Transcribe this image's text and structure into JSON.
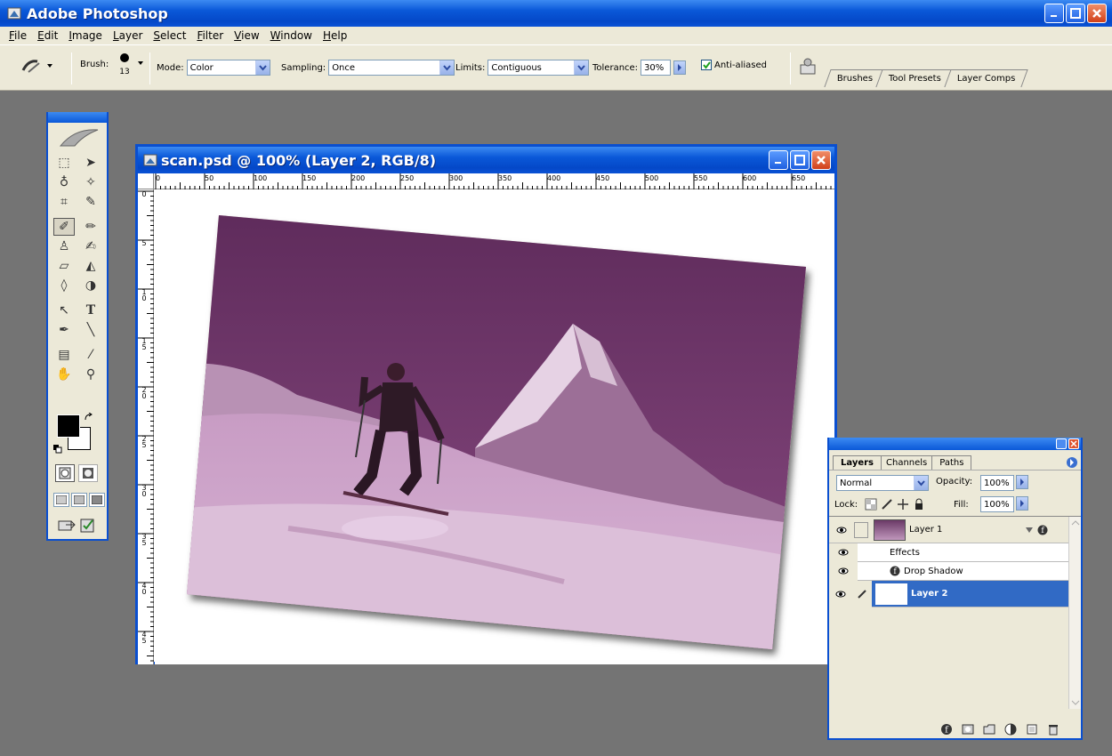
{
  "app": {
    "title": "Adobe Photoshop"
  },
  "menu": {
    "items": [
      "File",
      "Edit",
      "Image",
      "Layer",
      "Select",
      "Filter",
      "View",
      "Window",
      "Help"
    ]
  },
  "options": {
    "brush_label": "Brush:",
    "brush_size": "13",
    "mode_label": "Mode:",
    "mode_value": "Color",
    "sampling_label": "Sampling:",
    "sampling_value": "Once",
    "limits_label": "Limits:",
    "limits_value": "Contiguous",
    "tolerance_label": "Tolerance:",
    "tolerance_value": "30%",
    "antialiased_label": "Anti-aliased",
    "antialiased_checked": true
  },
  "palette_well": {
    "tabs": [
      "Brushes",
      "Tool Presets",
      "Layer Comps"
    ]
  },
  "document": {
    "title": "scan.psd @ 100% (Layer 2, RGB/8)",
    "ruler_h": [
      "0",
      "50",
      "100",
      "150",
      "200",
      "250",
      "300",
      "350",
      "400",
      "450",
      "500",
      "550",
      "600",
      "650"
    ],
    "ruler_v": [
      "0",
      "5",
      "10",
      "15",
      "20",
      "25",
      "30",
      "35",
      "40",
      "45"
    ]
  },
  "layers_panel": {
    "tabs": [
      "Layers",
      "Channels",
      "Paths"
    ],
    "blend_mode": "Normal",
    "opacity_label": "Opacity:",
    "opacity_value": "100%",
    "lock_label": "Lock:",
    "fill_label": "Fill:",
    "fill_value": "100%",
    "layer1_name": "Layer 1",
    "effects_label": "Effects",
    "drop_shadow_label": "Drop Shadow",
    "layer2_name": "Layer 2"
  },
  "colors": {
    "xp_blue": "#0a58d8",
    "chrome": "#ece9d8",
    "workspace": "#747474",
    "selected_layer": "#316ac5"
  }
}
